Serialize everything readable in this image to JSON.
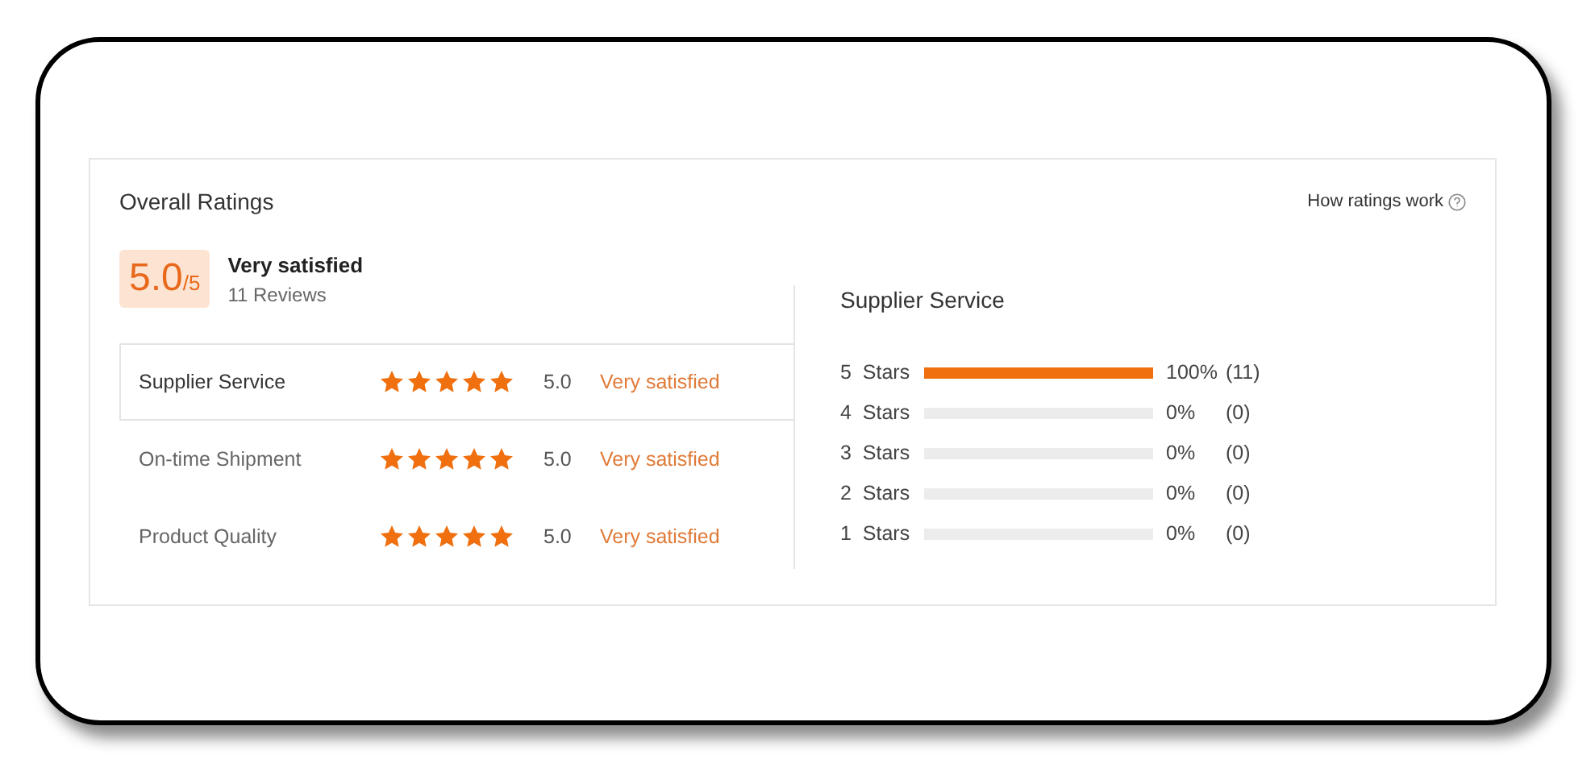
{
  "title": "Overall Ratings",
  "help_link": "How ratings work",
  "summary": {
    "score": "5.0",
    "out_of": "/5",
    "verdict": "Very satisfied",
    "reviews": "11 Reviews"
  },
  "aspects": [
    {
      "label": "Supplier Service",
      "stars": 5,
      "score": "5.0",
      "verdict": "Very satisfied",
      "selected": true
    },
    {
      "label": "On-time Shipment",
      "stars": 5,
      "score": "5.0",
      "verdict": "Very satisfied",
      "selected": false
    },
    {
      "label": "Product Quality",
      "stars": 5,
      "score": "5.0",
      "verdict": "Very satisfied",
      "selected": false
    }
  ],
  "detail": {
    "title": "Supplier Service",
    "breakdown": [
      {
        "label": "5  Stars",
        "level": 1,
        "percent": "100%",
        "count": "(11)"
      },
      {
        "label": "4  Stars",
        "level": 0,
        "percent": "0%",
        "count": "(0)"
      },
      {
        "label": "3  Stars",
        "level": 0,
        "percent": "0%",
        "count": "(0)"
      },
      {
        "label": "2  Stars",
        "level": 0,
        "percent": "0%",
        "count": "(0)"
      },
      {
        "label": "1  Stars",
        "level": 0,
        "percent": "0%",
        "count": "(0)"
      }
    ]
  }
}
